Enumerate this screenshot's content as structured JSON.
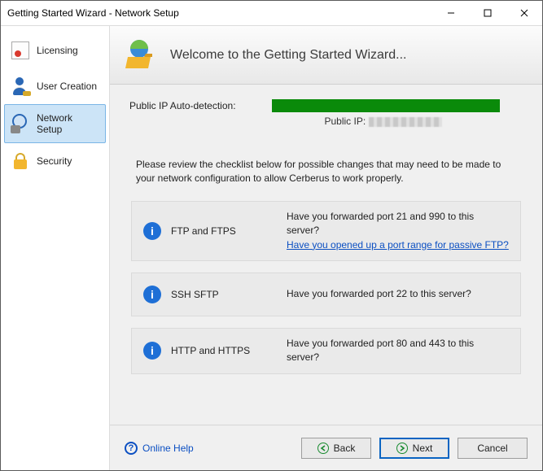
{
  "window": {
    "title": "Getting Started Wizard - Network Setup"
  },
  "sidebar": {
    "items": [
      {
        "label": "Licensing"
      },
      {
        "label": "User Creation"
      },
      {
        "label": "Network Setup"
      },
      {
        "label": "Security"
      }
    ]
  },
  "header": {
    "headline": "Welcome to the Getting Started Wizard..."
  },
  "ip": {
    "label": "Public IP Auto-detection:",
    "sub_prefix": "Public IP: "
  },
  "instructions": "Please review the checklist below for possible changes that may need to be made to your network configuration to allow Cerberus to work properly.",
  "checklist": [
    {
      "proto": "FTP and FTPS",
      "msg_line1": "Have you forwarded port 21 and 990 to this server?",
      "link": "Have you opened up a port range for passive FTP?"
    },
    {
      "proto": "SSH SFTP",
      "msg_line1": "Have you forwarded port 22 to this server?",
      "link": ""
    },
    {
      "proto": "HTTP and HTTPS",
      "msg_line1": "Have you forwarded port 80 and 443 to this server?",
      "link": ""
    }
  ],
  "footer": {
    "help": "Online Help",
    "back": "Back",
    "next": "Next",
    "cancel": "Cancel"
  }
}
